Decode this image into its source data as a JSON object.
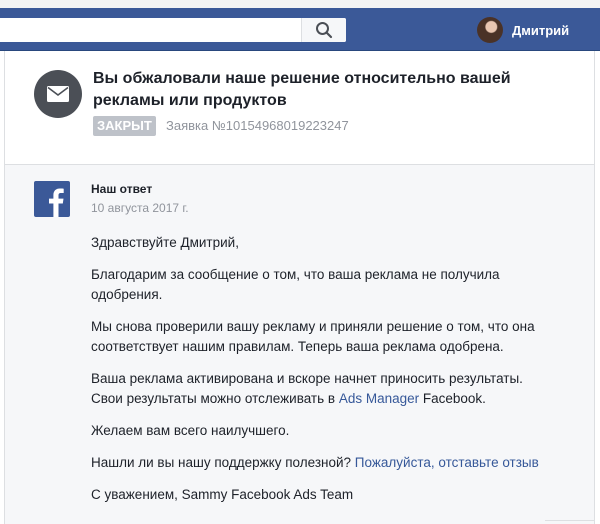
{
  "user": {
    "name": "Дмитрий"
  },
  "search": {
    "placeholder": ""
  },
  "header": {
    "title": "Вы обжаловали наше решение относительно вашей рекламы или продуктов",
    "status": "ЗАКРЫТ",
    "ticket": "Заявка №10154968019223247"
  },
  "response": {
    "title": "Наш ответ",
    "date": "10 августа 2017 г.",
    "greeting": "Здравствуйте Дмитрий,",
    "p1": "Благодарим за сообщение о том, что ваша реклама не получила одобрения.",
    "p2": "Мы снова проверили вашу рекламу и приняли решение о том, что она соответствует нашим правилам. Теперь ваша реклама одобрена.",
    "p3_before": "Ваша реклама активирована и вскоре начнет приносить результаты. Свои результаты можно отслеживать в ",
    "p3_link": "Ads Manager",
    "p3_after": " Facebook.",
    "p4": "Желаем вам всего наилучшего.",
    "p5_before": "Нашли ли вы нашу поддержку полезной? ",
    "p5_link": "Пожалуйста, отставьте отзыв",
    "signoff": "С уважением, Sammy Facebook Ads Team"
  },
  "colors": {
    "brand": "#3b5998",
    "link": "#365899",
    "badge": "#bec2c9"
  },
  "icons": {
    "search": "search-icon",
    "envelope": "envelope-icon",
    "logo": "facebook-logo-icon"
  }
}
